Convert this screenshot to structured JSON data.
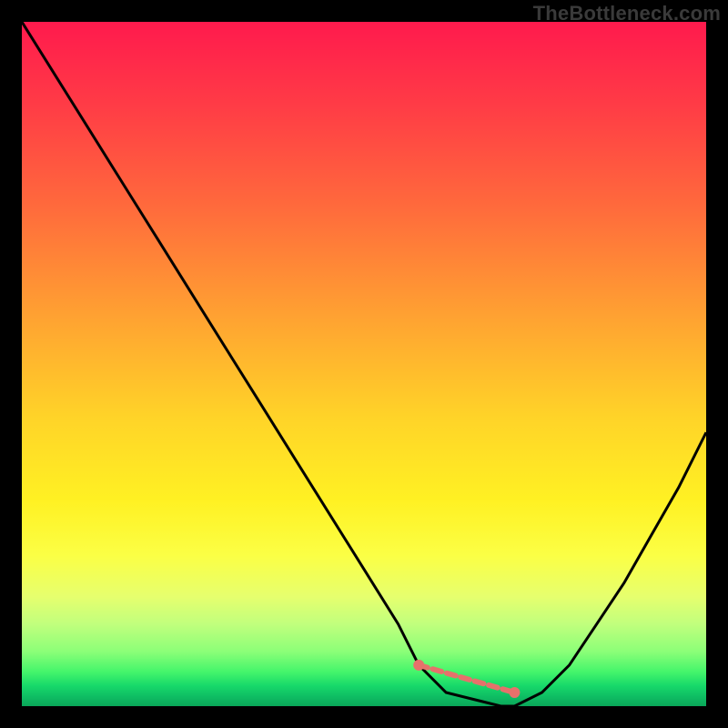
{
  "attribution": "TheBottleneck.com",
  "colors": {
    "page_bg": "#000000",
    "curve": "#000000",
    "marker": "#e6716b",
    "gradient_top": "#ff1a4d",
    "gradient_bottom": "#0aa659"
  },
  "chart_data": {
    "type": "line",
    "title": "",
    "xlabel": "",
    "ylabel": "",
    "xlim": [
      0,
      100
    ],
    "ylim": [
      0,
      100
    ],
    "grid": false,
    "legend": false,
    "series": [
      {
        "name": "bottleneck-curve",
        "x": [
          0,
          5,
          10,
          15,
          20,
          25,
          30,
          35,
          40,
          45,
          50,
          55,
          58,
          62,
          66,
          70,
          72,
          76,
          80,
          84,
          88,
          92,
          96,
          100
        ],
        "values": [
          100,
          92,
          84,
          76,
          68,
          60,
          52,
          44,
          36,
          28,
          20,
          12,
          6,
          2,
          1,
          0,
          0,
          2,
          6,
          12,
          18,
          25,
          32,
          40
        ]
      }
    ],
    "markers": [
      {
        "name": "optimal-left",
        "x": 58,
        "y": 6
      },
      {
        "name": "optimal-right",
        "x": 72,
        "y": 2
      }
    ],
    "annotations": []
  }
}
